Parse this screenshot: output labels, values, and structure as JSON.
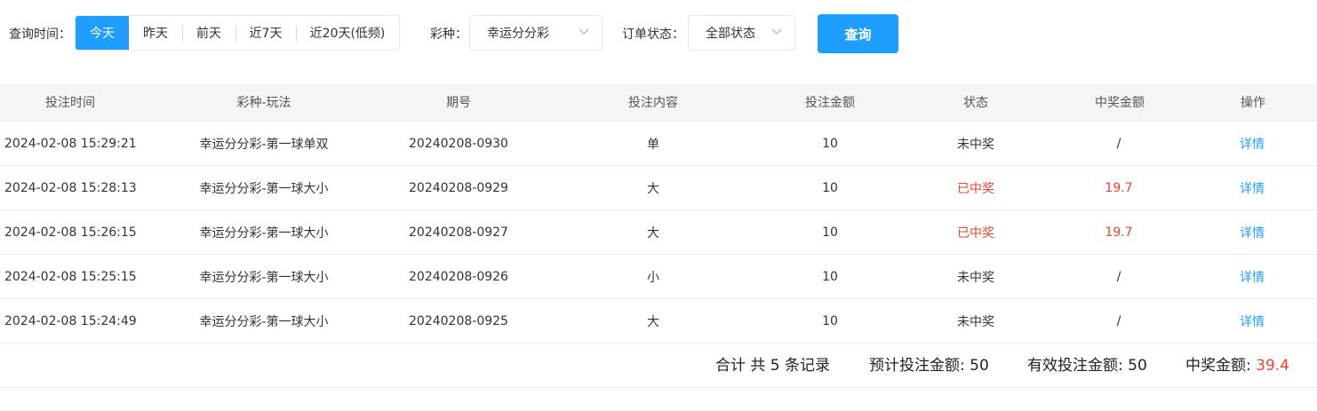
{
  "filters": {
    "date_label": "查询时间：",
    "date_options": [
      {
        "label": "今天",
        "active": true
      },
      {
        "label": "昨天",
        "active": false
      },
      {
        "label": "前天",
        "active": false
      },
      {
        "label": "近7天",
        "active": false
      },
      {
        "label": "近20天(低频)",
        "active": false
      }
    ],
    "lottery_label": "彩种：",
    "lottery_value": "幸运分分彩",
    "status_label": "订单状态：",
    "status_value": "全部状态",
    "query_button": "查询"
  },
  "table": {
    "headers": [
      "投注时间",
      "彩种-玩法",
      "期号",
      "投注内容",
      "投注金额",
      "状态",
      "中奖金额",
      "操作"
    ],
    "rows": [
      {
        "time": "2024-02-08 15:29:21",
        "game": "幸运分分彩-第一球单双",
        "issue": "20240208-0930",
        "content": "单",
        "amount": "10",
        "status": "未中奖",
        "won": false,
        "prize": "/",
        "action": "详情"
      },
      {
        "time": "2024-02-08 15:28:13",
        "game": "幸运分分彩-第一球大小",
        "issue": "20240208-0929",
        "content": "大",
        "amount": "10",
        "status": "已中奖",
        "won": true,
        "prize": "19.7",
        "action": "详情"
      },
      {
        "time": "2024-02-08 15:26:15",
        "game": "幸运分分彩-第一球大小",
        "issue": "20240208-0927",
        "content": "大",
        "amount": "10",
        "status": "已中奖",
        "won": true,
        "prize": "19.7",
        "action": "详情"
      },
      {
        "time": "2024-02-08 15:25:15",
        "game": "幸运分分彩-第一球大小",
        "issue": "20240208-0926",
        "content": "小",
        "amount": "10",
        "status": "未中奖",
        "won": false,
        "prize": "/",
        "action": "详情"
      },
      {
        "time": "2024-02-08 15:24:49",
        "game": "幸运分分彩-第一球大小",
        "issue": "20240208-0925",
        "content": "大",
        "amount": "10",
        "status": "未中奖",
        "won": false,
        "prize": "/",
        "action": "详情"
      }
    ]
  },
  "summary": {
    "total_records": "合计 共 5 条记录",
    "expected_label": "预计投注金额:",
    "expected_value": "50",
    "effective_label": "有效投注金额:",
    "effective_value": "50",
    "prize_label": "中奖金额:",
    "prize_value": "39.4"
  },
  "colors": {
    "accent": "#1e9fff",
    "won": "#e8432e",
    "header_bg": "#f4f5f7"
  }
}
